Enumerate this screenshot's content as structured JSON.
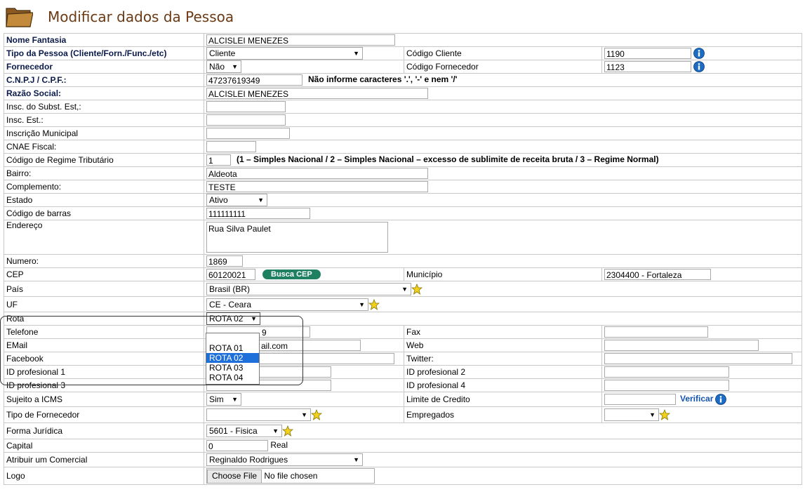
{
  "header": {
    "title": "Modificar dados da Pessoa",
    "icon": "folder-icon"
  },
  "rows": {
    "nome_fantasia": {
      "label": "Nome Fantasia",
      "value": "ALCISLEI MENEZES"
    },
    "tipo_pessoa": {
      "label": "Tipo da Pessoa (Cliente/Forn./Func./etc)",
      "value": "Cliente",
      "codigo_cliente_label": "Código Cliente",
      "codigo_cliente": "1190"
    },
    "fornecedor": {
      "label": "Fornecedor",
      "value": "Não",
      "codigo_fornecedor_label": "Código Fornecedor",
      "codigo_fornecedor": "1123"
    },
    "cnpj": {
      "label": "C.N.P.J / C.P.F.:",
      "value": "47237619349",
      "hint": "Não informe caracteres '.', '-' e nem '/'"
    },
    "razao_social": {
      "label": "Razão Social:",
      "value": "ALCISLEI MENEZES"
    },
    "insc_subst": {
      "label": "Insc. do Subst. Est,:",
      "value": ""
    },
    "insc_est": {
      "label": "Insc. Est.:",
      "value": ""
    },
    "insc_municipal": {
      "label": "Inscrição Municipal",
      "value": ""
    },
    "cnae": {
      "label": "CNAE Fiscal:",
      "value": ""
    },
    "regime": {
      "label": "Código de Regime Tributário",
      "value": "1",
      "hint": "(1 – Simples Nacional / 2 – Simples Nacional – excesso de sublimite de receita bruta / 3 – Regime Normal)"
    },
    "bairro": {
      "label": "Bairro:",
      "value": "Aldeota"
    },
    "complemento": {
      "label": "Complemento:",
      "value": "TESTE"
    },
    "estado": {
      "label": "Estado",
      "value": "Ativo"
    },
    "codigo_barras": {
      "label": "Código de barras",
      "value": "111111111"
    },
    "endereco": {
      "label": "Endereço",
      "value": "Rua Silva Paulet"
    },
    "numero": {
      "label": "Numero:",
      "value": "1869"
    },
    "cep": {
      "label": "CEP",
      "value": "60120021",
      "button": "Busca CEP",
      "municipio_label": "Município",
      "municipio": "2304400 - Fortaleza"
    },
    "pais": {
      "label": "País",
      "value": "Brasil (BR)"
    },
    "uf": {
      "label": "UF",
      "value": "CE - Ceara"
    },
    "rota": {
      "label": "Rota",
      "value": "ROTA 02",
      "options": [
        "ROTA 01",
        "ROTA 02",
        "ROTA 03",
        "ROTA 04"
      ]
    },
    "telefone": {
      "label": "Telefone",
      "value_partial": "9",
      "fax_label": "Fax",
      "fax": ""
    },
    "email": {
      "label": "EMail",
      "value_partial": "ail.com",
      "web_label": "Web",
      "web": ""
    },
    "facebook": {
      "label": "Facebook",
      "value": "",
      "twitter_label": "Twitter:",
      "twitter": ""
    },
    "id_prof_1": {
      "label": "ID profesional 1",
      "value": "",
      "id2_label": "ID profesional 2",
      "id2": ""
    },
    "id_prof_3": {
      "label": "ID profesional 3",
      "value": "",
      "id4_label": "ID profesional 4",
      "id4": ""
    },
    "icms": {
      "label": "Sujeito a ICMS",
      "value": "Sim",
      "limite_label": "Limite de Credito",
      "limite": "",
      "verificar": "Verificar"
    },
    "tipo_fornecedor": {
      "label": "Tipo de Fornecedor",
      "value": "",
      "empregados_label": "Empregados",
      "empregados": ""
    },
    "forma_juridica": {
      "label": "Forma Jurídica",
      "value": "5601 - Fisica"
    },
    "capital": {
      "label": "Capital",
      "value": "0",
      "unit": "Real"
    },
    "comercial": {
      "label": "Atribuir um Comercial",
      "value": "Reginaldo Rodrigues"
    },
    "logo": {
      "label": "Logo",
      "button": "Choose File",
      "status": "No file chosen"
    }
  },
  "colors": {
    "title": "#6b3a14",
    "label": "#0a1a4a",
    "busca_button": "#1e8060",
    "selected_option": "#1e6fd9",
    "link": "#1454b0"
  }
}
